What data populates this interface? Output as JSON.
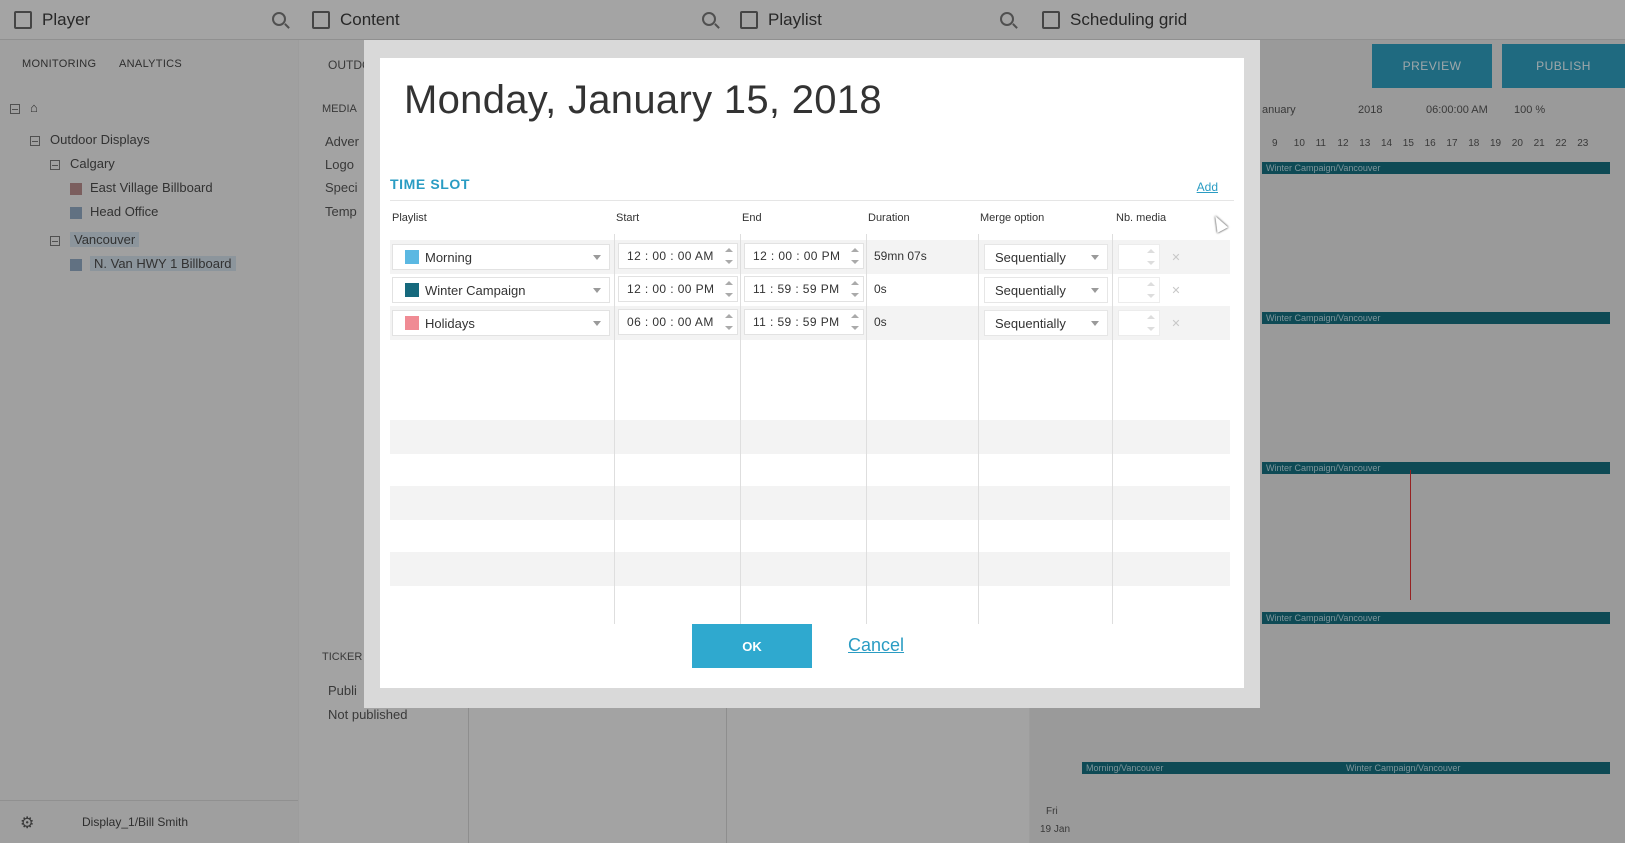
{
  "app": {
    "panels": [
      {
        "title": "Player"
      },
      {
        "title": "Content"
      },
      {
        "title": "Playlist"
      },
      {
        "title": "Scheduling grid"
      }
    ],
    "subnav": [
      "MONITORING",
      "ANALYTICS"
    ],
    "tree": {
      "root": "Outdoor Displays",
      "group1": "Calgary",
      "item1": "East Village Billboard",
      "item2": "Head Office",
      "group2": "Vancouver",
      "item3": "N. Van HWY 1 Billboard"
    },
    "middle": {
      "crumb": "OUTDO",
      "media_header": "MEDIA",
      "media_items": [
        "Adver",
        "Logo",
        "Speci",
        "Temp"
      ],
      "ticker_header": "TICKER",
      "ticker_items": [
        "Publi",
        "Not published"
      ]
    },
    "right": {
      "preview": "PREVIEW",
      "publish": "PUBLISH",
      "month": "anuary",
      "year": "2018",
      "time": "06:00:00 AM",
      "zoom": "100 %",
      "hours": [
        "9",
        "10",
        "11",
        "12",
        "13",
        "14",
        "15",
        "16",
        "17",
        "18",
        "19",
        "20",
        "21",
        "22",
        "23"
      ],
      "bar_label": "Winter Campaign/Vancouver",
      "bar_label_morning": "Morning/Vancouver",
      "day": "Fri",
      "date": "19 Jan"
    },
    "footer_user": "Display_1/Bill Smith"
  },
  "dialog": {
    "title": "Monday, January 15, 2018",
    "section": "TIME SLOT",
    "add": "Add",
    "headers": {
      "playlist": "Playlist",
      "start": "Start",
      "end": "End",
      "duration": "Duration",
      "merge": "Merge option",
      "nb": "Nb. media"
    },
    "rows": [
      {
        "playlist": "Morning",
        "color": "#5bb8e2",
        "start": "12 : 00 : 00 AM",
        "end": "12 : 00 : 00 PM",
        "duration": "59mn 07s",
        "merge": "Sequentially"
      },
      {
        "playlist": "Winter Campaign",
        "color": "#16697d",
        "start": "12 : 00 : 00 PM",
        "end": "11 : 59 : 59 PM",
        "duration": "0s",
        "merge": "Sequentially"
      },
      {
        "playlist": "Holidays",
        "color": "#f08b94",
        "start": "06 : 00 : 00 AM",
        "end": "11 : 59 : 59 PM",
        "duration": "0s",
        "merge": "Sequentially"
      }
    ],
    "ok": "OK",
    "cancel": "Cancel"
  }
}
